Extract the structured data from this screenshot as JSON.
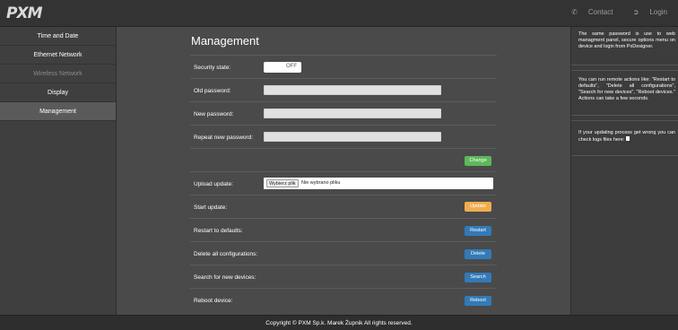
{
  "brand": {
    "logo_text": "PXM"
  },
  "topnav": {
    "contact_label": "Contact",
    "login_label": "Login",
    "phone_icon": "phone-icon",
    "login_icon": "login-icon"
  },
  "sidebar": {
    "items": [
      {
        "label": "Time and Date",
        "state": "normal"
      },
      {
        "label": "Ethernet Network",
        "state": "normal"
      },
      {
        "label": "Wireless Network",
        "state": "disabled"
      },
      {
        "label": "Display",
        "state": "normal"
      },
      {
        "label": "Management",
        "state": "active"
      }
    ]
  },
  "main": {
    "title": "Management",
    "security_state": {
      "label": "Security state:",
      "toggle_text": "OFF"
    },
    "old_password": {
      "label": "Old password:",
      "value": ""
    },
    "new_password": {
      "label": "New password:",
      "value": ""
    },
    "repeat_password": {
      "label": "Repeat new password:",
      "value": ""
    },
    "change_button": "Change",
    "upload_update": {
      "label": "Upload update:",
      "file_button": "Wybierz plik",
      "file_text": "Nie wybrano pliku"
    },
    "start_update": {
      "label": "Start update:",
      "button": "Update"
    },
    "restart_defaults": {
      "label": "Restart to defaults:",
      "button": "Restart"
    },
    "delete_configs": {
      "label": "Delete all configurations:",
      "button": "Delete"
    },
    "search_devices": {
      "label": "Search for new devices:",
      "button": "Search"
    },
    "reboot_device": {
      "label": "Reboot device:",
      "button": "Reboot"
    }
  },
  "info": {
    "block1": "The same password is use to web managment panel, secure options menu on device and login from PxDesigner.",
    "block2": "You can run remote actions like: \"Restart to defaults\", \"Delete all configurations\", \"Search for new devices\", \"Reboot devices.\" Actions can take a few seconds.",
    "block3": "If your updating process get wrong you can check logs files here:",
    "file_icon": "file-icon"
  },
  "footer": {
    "copyright": "Copyright © PXM Sp.k. Marek Żupnik All rights reserved."
  },
  "colors": {
    "green": "#5cb85c",
    "orange": "#f0ad4e",
    "blue": "#337ab7"
  }
}
